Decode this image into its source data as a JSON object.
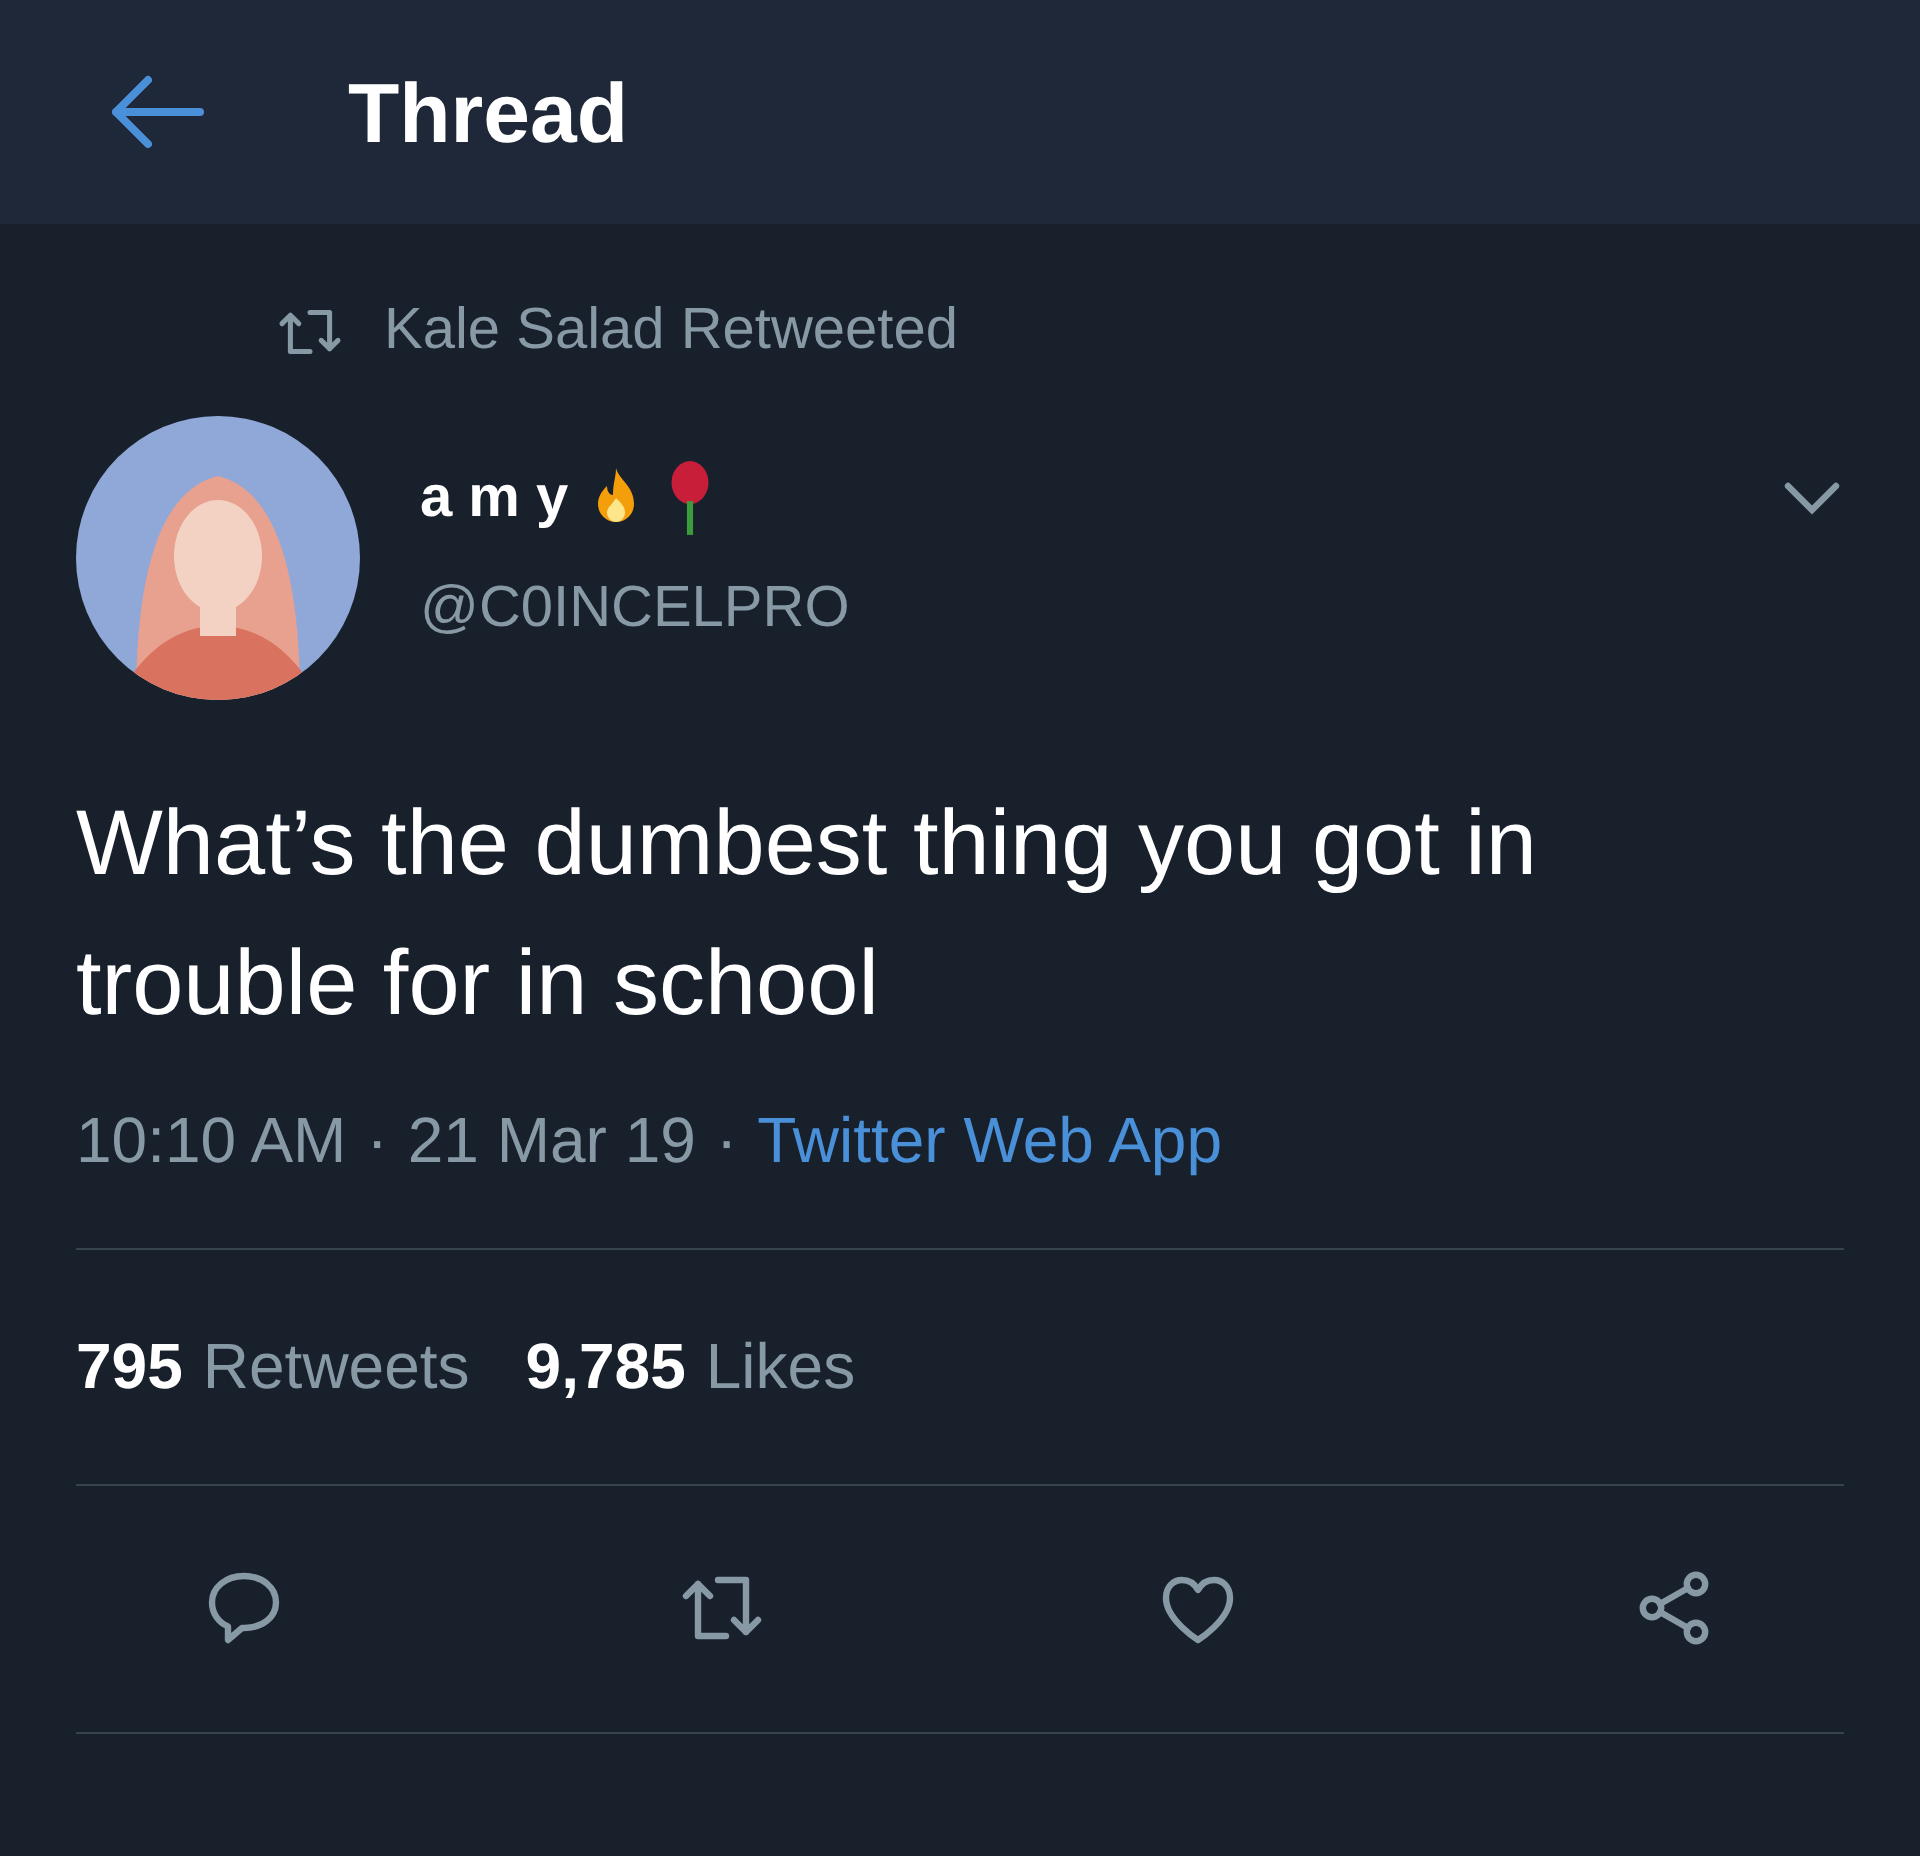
{
  "header": {
    "title": "Thread"
  },
  "retweet_context": {
    "text": "Kale Salad Retweeted"
  },
  "tweet": {
    "name": "a m y",
    "handle": "@C0INCELPRO",
    "text": "What’s the dumbest thing you got in trouble for in school",
    "separator": "·",
    "time": "10:10 AM",
    "date": "21 Mar 19",
    "source": "Twitter Web App",
    "stats": [
      {
        "count": "795",
        "label": "Retweets"
      },
      {
        "count": "9,785",
        "label": "Likes"
      }
    ],
    "actions": [
      {
        "kind": "reply"
      },
      {
        "kind": "retweet"
      },
      {
        "kind": "like"
      },
      {
        "kind": "share"
      }
    ]
  }
}
